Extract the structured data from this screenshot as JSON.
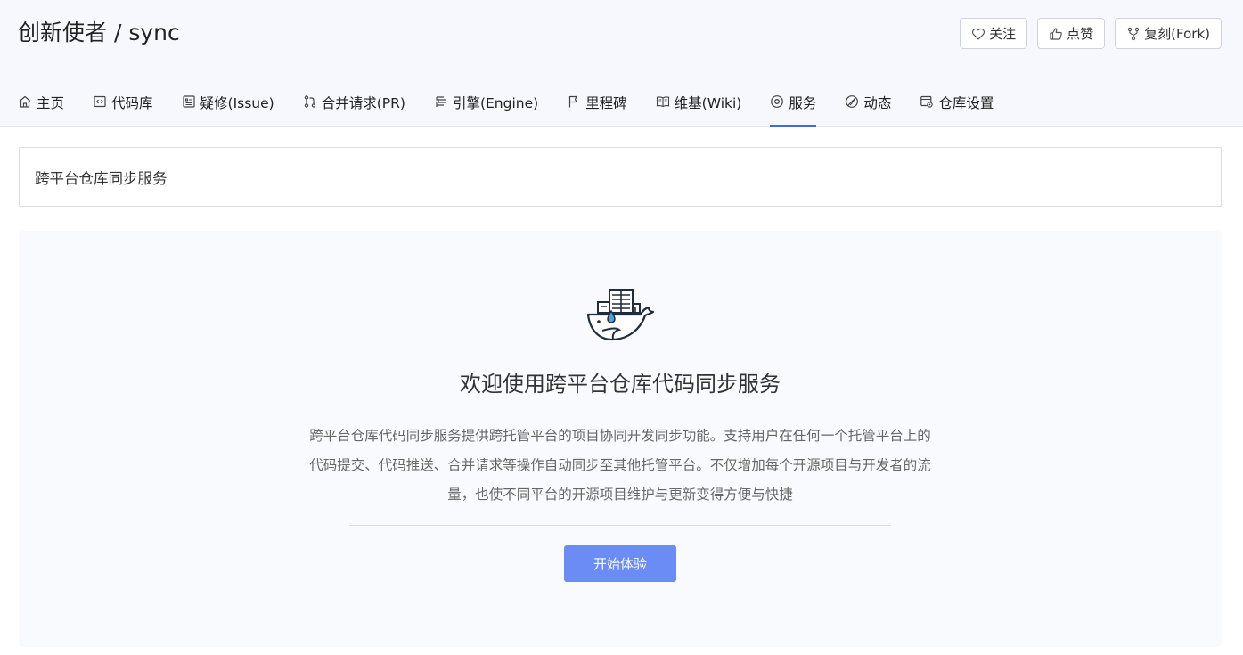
{
  "repo": {
    "title": "创新使者 / sync"
  },
  "actions": [
    {
      "label": "关注",
      "icon": "heart-icon"
    },
    {
      "label": "点赞",
      "icon": "thumbs-up-icon"
    },
    {
      "label": "复刻(Fork)",
      "icon": "fork-icon"
    }
  ],
  "tabs": [
    {
      "label": "主页",
      "icon": "home-icon"
    },
    {
      "label": "代码库",
      "icon": "code-icon"
    },
    {
      "label": "疑修(Issue)",
      "icon": "issue-icon"
    },
    {
      "label": "合并请求(PR)",
      "icon": "pull-request-icon"
    },
    {
      "label": "引擎(Engine)",
      "icon": "engine-icon"
    },
    {
      "label": "里程碑",
      "icon": "flag-icon"
    },
    {
      "label": "维基(Wiki)",
      "icon": "book-icon"
    },
    {
      "label": "服务",
      "icon": "service-icon",
      "active": true
    },
    {
      "label": "动态",
      "icon": "activity-icon"
    },
    {
      "label": "仓库设置",
      "icon": "settings-icon"
    }
  ],
  "service_bar": {
    "title": "跨平台仓库同步服务"
  },
  "panel": {
    "heading": "欢迎使用跨平台仓库代码同步服务",
    "description_lines": [
      "跨平台仓库代码同步服务提供跨托管平台的项目协同开发同步功能。支持用户在任何一个托管平台上的",
      "代码提交、代码推送、合并请求等操作自动同步至其他托管平台。不仅增加每个开源项目与开发者的流",
      "量，也使不同平台的开源项目维护与更新变得方便与快捷"
    ],
    "start_label": "开始体验",
    "illustration": "docker-whale-icon"
  },
  "colors": {
    "accent": "#466bd9",
    "button": "#6b8cf5",
    "header_bg": "#f7f8fd",
    "panel_bg": "#f9fafe"
  }
}
